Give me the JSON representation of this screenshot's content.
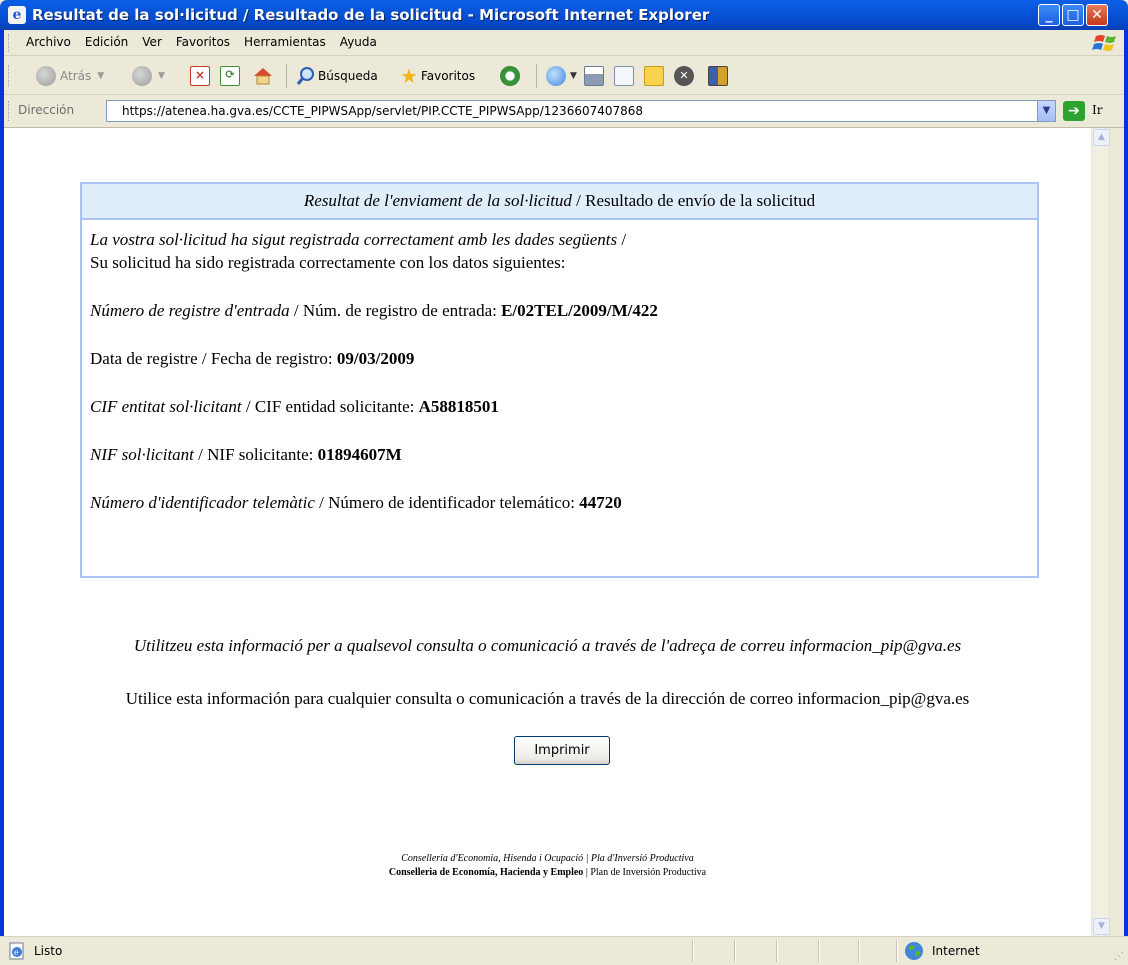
{
  "window": {
    "title": "Resultat de la sol·licitud / Resultado de la solicitud - Microsoft Internet Explorer",
    "app_icon": "internet-explorer-icon"
  },
  "menubar": {
    "items": [
      "Archivo",
      "Edición",
      "Ver",
      "Favoritos",
      "Herramientas",
      "Ayuda"
    ]
  },
  "toolbar": {
    "back_label": "Atrás",
    "search_label": "Búsqueda",
    "favorites_label": "Favoritos"
  },
  "address": {
    "label": "Dirección",
    "url": "https://atenea.ha.gva.es/CCTE_PIPWSApp/servlet/PIP.CCTE_PIPWSApp/1236607407868",
    "go_label": "Ir"
  },
  "result": {
    "header_ca": "Resultat de l'enviament de la sol·licitud",
    "header_sep": " / ",
    "header_es": "Resultado de envío de la solicitud",
    "intro_ca": "La vostra sol·licitud ha sigut registrada correctament amb les dades següents",
    "intro_sep": " /",
    "intro_es": "Su solicitud ha sido registrada correctamente con los datos siguientes:",
    "fields": [
      {
        "label_ca": "Número de registre d'entrada",
        "sep": " / ",
        "label_es": "Núm. de registro de entrada: ",
        "value": "E/02TEL/2009/M/422"
      },
      {
        "label_ca": "",
        "sep": "",
        "label_es": "Data de registre / Fecha de registro: ",
        "value": "09/03/2009"
      },
      {
        "label_ca": "CIF entitat sol·licitant",
        "sep": " / ",
        "label_es": "CIF entidad solicitante: ",
        "value": "A58818501"
      },
      {
        "label_ca": "NIF sol·licitant",
        "sep": " / ",
        "label_es": "NIF solicitante: ",
        "value": "01894607M"
      },
      {
        "label_ca": "Número d'identificador telemàtic",
        "sep": " / ",
        "label_es": "Número de identificador telemático: ",
        "value": "44720"
      }
    ]
  },
  "notice": {
    "ca": "Utilitzeu esta informació per a qualsevol consulta o comunicació a través de l'adreça de correu informacion_pip@gva.es",
    "es": "Utilice esta información para cualquier consulta o comunicación a través de la dirección de correo informacion_pip@gva.es"
  },
  "print_button": "Imprimir",
  "footer": {
    "line1": "Conselleria d'Economia, Hisenda i Ocupació | Pla d'Inversió Productiva",
    "line2_bold": "Conselleria de Economía, Hacienda y Empleo",
    "line2_rest": " | Plan de Inversión Productiva"
  },
  "statusbar": {
    "text": "Listo",
    "zone": "Internet"
  }
}
